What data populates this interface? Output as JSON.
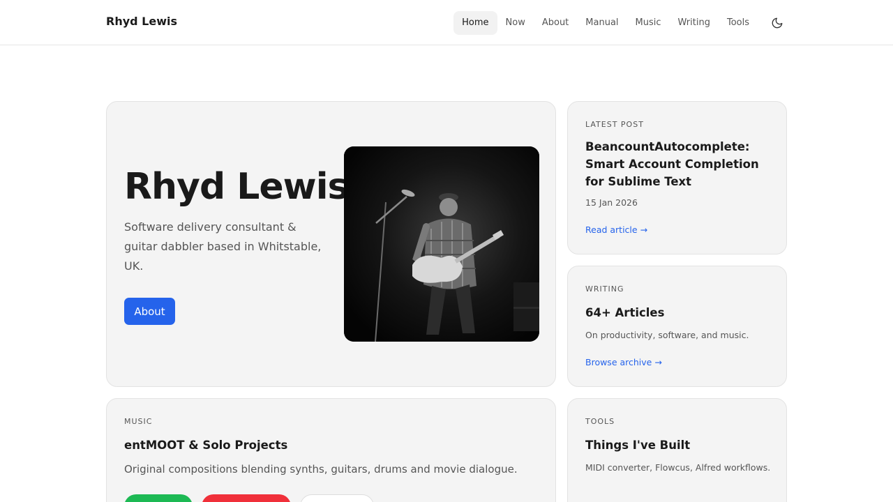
{
  "header": {
    "brand": "Rhyd Lewis",
    "nav": [
      "Home",
      "Now",
      "About",
      "Manual",
      "Music",
      "Writing",
      "Tools"
    ],
    "active": "Home",
    "theme_icon": "moon-icon"
  },
  "hero": {
    "title": "Rhyd Lewis",
    "subtitle": "Software delivery consultant & guitar dabbler based in Whitstable, UK.",
    "button": "About",
    "photo": "guitarist-photo"
  },
  "latest": {
    "eyebrow": "LATEST POST",
    "title": "BeancountAutocomplete: Smart Account Completion for Sublime Text",
    "date": "15 Jan 2026",
    "link": "Read article →"
  },
  "writing": {
    "eyebrow": "WRITING",
    "title": "64+ Articles",
    "desc": "On productivity, software, and music.",
    "link": "Browse archive →"
  },
  "music": {
    "eyebrow": "MUSIC",
    "title": "entMOOT & Solo Projects",
    "desc": "Original compositions blending synths, guitars, drums and movie dialogue."
  },
  "tools": {
    "eyebrow": "TOOLS",
    "title": "Things I've Built",
    "desc": "MIDI converter, Flowcus, Alfred workflows."
  },
  "colors": {
    "accent": "#2563eb",
    "card_bg": "#f4f4f4",
    "spotify": "#1db954",
    "youtube": "#f0303a"
  }
}
